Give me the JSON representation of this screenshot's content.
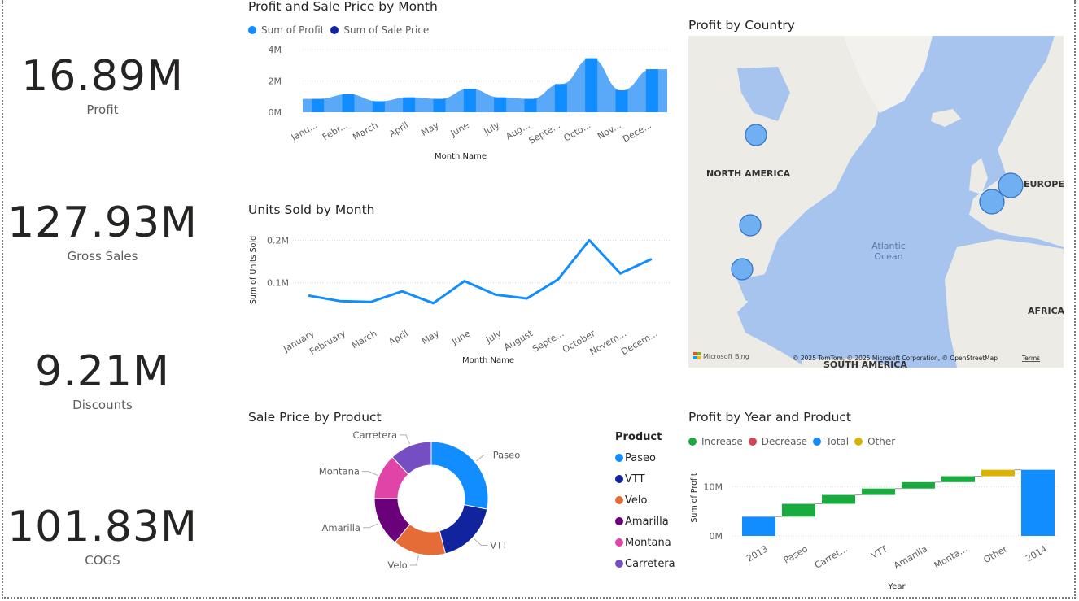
{
  "kpis": [
    {
      "value": "16.89M",
      "label": "Profit"
    },
    {
      "value": "127.93M",
      "label": "Gross Sales"
    },
    {
      "value": "9.21M",
      "label": "Discounts"
    },
    {
      "value": "101.83M",
      "label": "COGS"
    }
  ],
  "profit_sale": {
    "title": "Profit and Sale Price by Month",
    "legend": [
      {
        "name": "Sum of Profit",
        "color": "#118DFF"
      },
      {
        "name": "Sum of Sale Price",
        "color": "#12239E"
      }
    ],
    "yticks": [
      "4M",
      "2M",
      "0M"
    ],
    "xlabel": "Month Name"
  },
  "units": {
    "title": "Units Sold by Month",
    "ylabel": "Sum of Units Sold",
    "yticks": [
      "0.2M",
      "0.1M"
    ],
    "xlabel": "Month Name"
  },
  "map": {
    "title": "Profit by Country",
    "labels": {
      "north_america": "NORTH AMERICA",
      "europe": "EUROPE",
      "africa": "AFRICA",
      "south_america": "SOUTH AMERICA",
      "ocean1": "Atlantic",
      "ocean2": "Ocean"
    },
    "bing": "Microsoft Bing",
    "copyright": "© 2025 TomTom, © 2025 Microsoft Corporation, © OpenStreetMap",
    "terms": "Terms"
  },
  "donut": {
    "title": "Sale Price by Product",
    "legend_title": "Product",
    "labels": {
      "paseo": "Paseo",
      "vtt": "VTT",
      "velo": "Velo",
      "amarilla": "Amarilla",
      "montana": "Montana",
      "carretera": "Carretera"
    }
  },
  "waterfall": {
    "title": "Profit by Year and Product",
    "legend": [
      {
        "name": "Increase",
        "color": "#1AAB40"
      },
      {
        "name": "Decrease",
        "color": "#D64554"
      },
      {
        "name": "Total",
        "color": "#118DFF"
      },
      {
        "name": "Other",
        "color": "#D9B300"
      }
    ],
    "ylabel": "Sum of Profit",
    "yticks": [
      "10M",
      "0M"
    ],
    "xlabel": "Year"
  },
  "chart_data": [
    {
      "type": "bar",
      "title": "Profit and Sale Price by Month",
      "xlabel": "Month Name",
      "categories": [
        "January",
        "February",
        "March",
        "April",
        "May",
        "June",
        "July",
        "August",
        "September",
        "October",
        "November",
        "December"
      ],
      "tick_labels": [
        "Janu...",
        "Febr...",
        "March",
        "April",
        "May",
        "June",
        "July",
        "Aug...",
        "Septe...",
        "Octo...",
        "Nov...",
        "Dece..."
      ],
      "ylim": [
        0,
        4000000
      ],
      "series": [
        {
          "name": "Sum of Profit",
          "values": [
            850000,
            1150000,
            700000,
            950000,
            850000,
            1500000,
            950000,
            850000,
            1800000,
            3450000,
            1400000,
            2750000
          ]
        }
      ],
      "legend": "top-left",
      "grid": true
    },
    {
      "type": "line",
      "title": "Units Sold by Month",
      "xlabel": "Month Name",
      "ylabel": "Sum of Units Sold",
      "categories": [
        "January",
        "February",
        "March",
        "April",
        "May",
        "June",
        "July",
        "August",
        "September",
        "October",
        "November",
        "December"
      ],
      "tick_labels": [
        "January",
        "February",
        "March",
        "April",
        "May",
        "June",
        "July",
        "August",
        "Septe...",
        "October",
        "Novem...",
        "Decem..."
      ],
      "ylim": [
        0,
        0.22
      ],
      "series": [
        {
          "values": [
            0.07,
            0.057,
            0.055,
            0.08,
            0.052,
            0.104,
            0.072,
            0.063,
            0.108,
            0.2,
            0.122,
            0.156
          ]
        }
      ],
      "grid": true
    },
    {
      "type": "pie",
      "title": "Sale Price by Product",
      "categories": [
        "Paseo",
        "VTT",
        "Velo",
        "Amarilla",
        "Montana",
        "Carretera"
      ],
      "values": [
        28,
        18,
        15,
        14,
        13,
        12
      ],
      "colors": [
        "#118DFF",
        "#12239E",
        "#E66C37",
        "#6B007B",
        "#E044A7",
        "#744EC2"
      ],
      "legend": "right"
    },
    {
      "type": "bar",
      "title": "Profit by Year and Product",
      "xlabel": "Year",
      "ylabel": "Sum of Profit",
      "categories": [
        "2013",
        "Paseo",
        "Carret...",
        "VTT",
        "Amarilla",
        "Monta...",
        "Other",
        "2014"
      ],
      "series": [
        {
          "name": "Increase/Total",
          "values": [
            3900000,
            2600000,
            1800000,
            1300000,
            1300000,
            1200000,
            1300000,
            13400000
          ]
        }
      ],
      "kinds": [
        "total",
        "increase",
        "increase",
        "increase",
        "increase",
        "increase",
        "other",
        "total"
      ],
      "ylim": [
        0,
        14000000
      ],
      "legend": "top-left"
    }
  ]
}
